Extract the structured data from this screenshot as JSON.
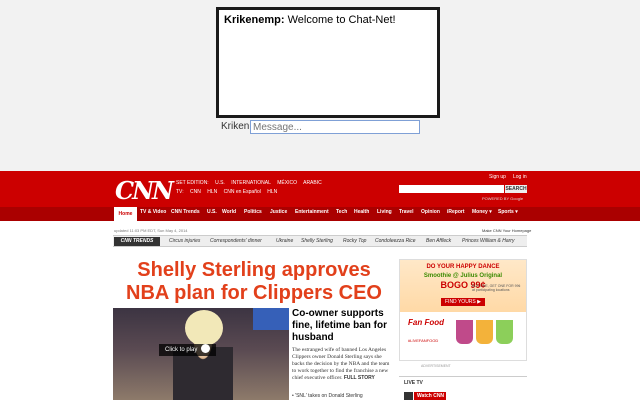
{
  "chat": {
    "message_user": "Krikenemp:",
    "message_text": "Welcome to Chat-Net!",
    "name_label": "Kriken",
    "input_placeholder": "Message..."
  },
  "cnn": {
    "logo": "CNN",
    "edition_label": "SET EDITION:",
    "editions": [
      "U.S.",
      "INTERNATIONAL",
      "MÉXICO",
      "ARABIC"
    ],
    "tv_label": "TV:",
    "tv_links": [
      "CNN",
      "HLN",
      "CNN en Español",
      "HLN"
    ],
    "sign_up": "Sign up",
    "log_in": "Log in",
    "search_button": "SEARCH",
    "powered_by": "POWERED BY Google",
    "nav": [
      "Home",
      "TV & Video",
      "CNN Trends",
      "U.S.",
      "World",
      "Politics",
      "Justice",
      "Entertainment",
      "Tech",
      "Health",
      "Living",
      "Travel",
      "Opinion",
      "iReport",
      "Money ▾",
      "Sports ▾"
    ],
    "updated": "updated 11:03 PM EDT, Sun May 4, 2014",
    "make_homepage": "Make CNN Your Homepage",
    "trends_logo": "CNN TRENDS",
    "trends": [
      "Circus injuries",
      "Correspondents' dinner",
      "Ukraine",
      "Shelly Sterling",
      "Rocky Top",
      "Condoleezza Rice",
      "Ben Affleck",
      "Princes William & Harry"
    ],
    "headline": "Shelly Sterling approves NBA plan for Clippers CEO",
    "play_label": "Click to play",
    "subhead": "Co-owner supports fine, lifetime ban for husband",
    "body": "The estranged wife of banned Los Angeles Clippers owner Donald Sterling says she backs the decision by the NBA and the team to work together to find the franchise a new chief executive officer.",
    "full_story": "FULL STORY",
    "bullet": "• 'SNL' takes on Donald Sterling",
    "live_tv": "LIVE TV",
    "watch_cnn": "Watch CNN"
  },
  "ad": {
    "happy": "DO YOUR HAPPY DANCE",
    "smoothie": "Smoothie @ Julius Original",
    "bogo": "BOGO 99¢",
    "find": "FIND YOURS ▶",
    "fine_print": "BUY ONE, GET ONE FOR 99¢ at participating locations",
    "brand": "Fan Food",
    "hashtag": "#LIVEFANFOOD",
    "label": "ADVERTISEMENT"
  }
}
